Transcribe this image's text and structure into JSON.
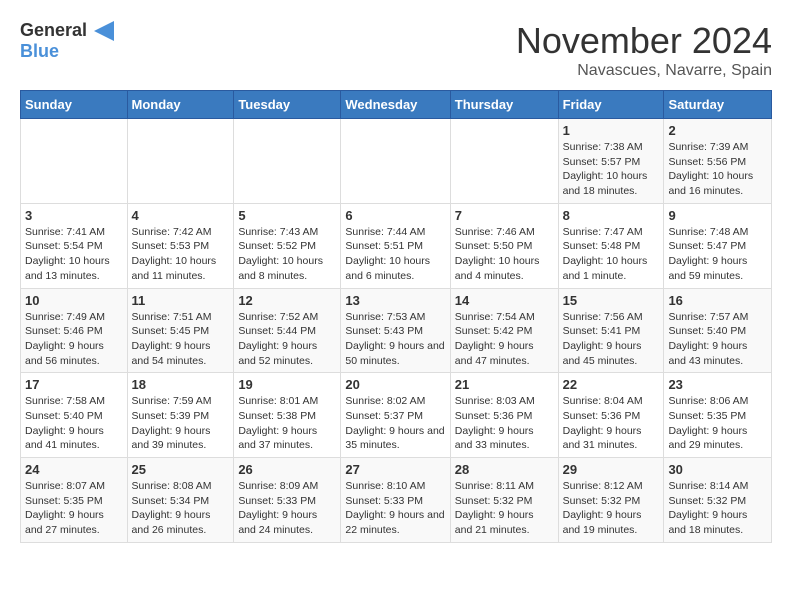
{
  "header": {
    "logo_line1": "General",
    "logo_line2": "Blue",
    "month": "November 2024",
    "location": "Navascues, Navarre, Spain"
  },
  "weekdays": [
    "Sunday",
    "Monday",
    "Tuesday",
    "Wednesday",
    "Thursday",
    "Friday",
    "Saturday"
  ],
  "weeks": [
    [
      {
        "day": "",
        "info": ""
      },
      {
        "day": "",
        "info": ""
      },
      {
        "day": "",
        "info": ""
      },
      {
        "day": "",
        "info": ""
      },
      {
        "day": "",
        "info": ""
      },
      {
        "day": "1",
        "info": "Sunrise: 7:38 AM\nSunset: 5:57 PM\nDaylight: 10 hours and 18 minutes."
      },
      {
        "day": "2",
        "info": "Sunrise: 7:39 AM\nSunset: 5:56 PM\nDaylight: 10 hours and 16 minutes."
      }
    ],
    [
      {
        "day": "3",
        "info": "Sunrise: 7:41 AM\nSunset: 5:54 PM\nDaylight: 10 hours and 13 minutes."
      },
      {
        "day": "4",
        "info": "Sunrise: 7:42 AM\nSunset: 5:53 PM\nDaylight: 10 hours and 11 minutes."
      },
      {
        "day": "5",
        "info": "Sunrise: 7:43 AM\nSunset: 5:52 PM\nDaylight: 10 hours and 8 minutes."
      },
      {
        "day": "6",
        "info": "Sunrise: 7:44 AM\nSunset: 5:51 PM\nDaylight: 10 hours and 6 minutes."
      },
      {
        "day": "7",
        "info": "Sunrise: 7:46 AM\nSunset: 5:50 PM\nDaylight: 10 hours and 4 minutes."
      },
      {
        "day": "8",
        "info": "Sunrise: 7:47 AM\nSunset: 5:48 PM\nDaylight: 10 hours and 1 minute."
      },
      {
        "day": "9",
        "info": "Sunrise: 7:48 AM\nSunset: 5:47 PM\nDaylight: 9 hours and 59 minutes."
      }
    ],
    [
      {
        "day": "10",
        "info": "Sunrise: 7:49 AM\nSunset: 5:46 PM\nDaylight: 9 hours and 56 minutes."
      },
      {
        "day": "11",
        "info": "Sunrise: 7:51 AM\nSunset: 5:45 PM\nDaylight: 9 hours and 54 minutes."
      },
      {
        "day": "12",
        "info": "Sunrise: 7:52 AM\nSunset: 5:44 PM\nDaylight: 9 hours and 52 minutes."
      },
      {
        "day": "13",
        "info": "Sunrise: 7:53 AM\nSunset: 5:43 PM\nDaylight: 9 hours and 50 minutes."
      },
      {
        "day": "14",
        "info": "Sunrise: 7:54 AM\nSunset: 5:42 PM\nDaylight: 9 hours and 47 minutes."
      },
      {
        "day": "15",
        "info": "Sunrise: 7:56 AM\nSunset: 5:41 PM\nDaylight: 9 hours and 45 minutes."
      },
      {
        "day": "16",
        "info": "Sunrise: 7:57 AM\nSunset: 5:40 PM\nDaylight: 9 hours and 43 minutes."
      }
    ],
    [
      {
        "day": "17",
        "info": "Sunrise: 7:58 AM\nSunset: 5:40 PM\nDaylight: 9 hours and 41 minutes."
      },
      {
        "day": "18",
        "info": "Sunrise: 7:59 AM\nSunset: 5:39 PM\nDaylight: 9 hours and 39 minutes."
      },
      {
        "day": "19",
        "info": "Sunrise: 8:01 AM\nSunset: 5:38 PM\nDaylight: 9 hours and 37 minutes."
      },
      {
        "day": "20",
        "info": "Sunrise: 8:02 AM\nSunset: 5:37 PM\nDaylight: 9 hours and 35 minutes."
      },
      {
        "day": "21",
        "info": "Sunrise: 8:03 AM\nSunset: 5:36 PM\nDaylight: 9 hours and 33 minutes."
      },
      {
        "day": "22",
        "info": "Sunrise: 8:04 AM\nSunset: 5:36 PM\nDaylight: 9 hours and 31 minutes."
      },
      {
        "day": "23",
        "info": "Sunrise: 8:06 AM\nSunset: 5:35 PM\nDaylight: 9 hours and 29 minutes."
      }
    ],
    [
      {
        "day": "24",
        "info": "Sunrise: 8:07 AM\nSunset: 5:35 PM\nDaylight: 9 hours and 27 minutes."
      },
      {
        "day": "25",
        "info": "Sunrise: 8:08 AM\nSunset: 5:34 PM\nDaylight: 9 hours and 26 minutes."
      },
      {
        "day": "26",
        "info": "Sunrise: 8:09 AM\nSunset: 5:33 PM\nDaylight: 9 hours and 24 minutes."
      },
      {
        "day": "27",
        "info": "Sunrise: 8:10 AM\nSunset: 5:33 PM\nDaylight: 9 hours and 22 minutes."
      },
      {
        "day": "28",
        "info": "Sunrise: 8:11 AM\nSunset: 5:32 PM\nDaylight: 9 hours and 21 minutes."
      },
      {
        "day": "29",
        "info": "Sunrise: 8:12 AM\nSunset: 5:32 PM\nDaylight: 9 hours and 19 minutes."
      },
      {
        "day": "30",
        "info": "Sunrise: 8:14 AM\nSunset: 5:32 PM\nDaylight: 9 hours and 18 minutes."
      }
    ]
  ]
}
